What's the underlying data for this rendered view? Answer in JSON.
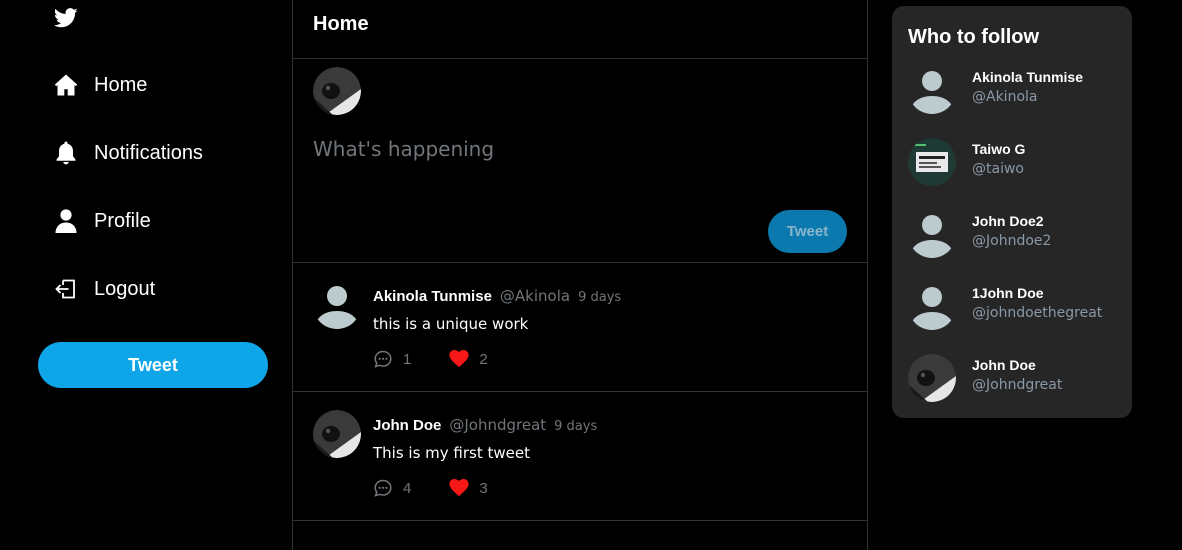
{
  "sidebar": {
    "logo_icon": "twitter-bird-icon",
    "items": [
      {
        "label": "Home",
        "icon": "home-icon"
      },
      {
        "label": "Notifications",
        "icon": "bell-icon"
      },
      {
        "label": "Profile",
        "icon": "user-icon"
      },
      {
        "label": "Logout",
        "icon": "logout-icon"
      }
    ],
    "tweet_button_label": "Tweet"
  },
  "main": {
    "title": "Home",
    "composer": {
      "placeholder": "What's happening",
      "button_label": "Tweet"
    },
    "tweets": [
      {
        "name": "Akinola Tunmise",
        "handle": "@Akinola",
        "time": "9 days",
        "text": "this is a unique work",
        "avatar": "default-avatar",
        "comments": "1",
        "likes": "2"
      },
      {
        "name": "John Doe",
        "handle": "@Johndgreat",
        "time": "9 days",
        "text": "This is my first tweet",
        "avatar": "photo-avatar",
        "comments": "4",
        "likes": "3"
      }
    ]
  },
  "who_to_follow": {
    "title": "Who to follow",
    "users": [
      {
        "name": "Akinola Tunmise",
        "handle": "@Akinola",
        "avatar": "default-avatar"
      },
      {
        "name": "Taiwo G",
        "handle": "@taiwo",
        "avatar": "screenshot-avatar"
      },
      {
        "name": "John Doe2",
        "handle": "@Johndoe2",
        "avatar": "default-avatar"
      },
      {
        "name": "1John Doe",
        "handle": "@johndoethegreat",
        "avatar": "default-avatar"
      },
      {
        "name": "John Doe",
        "handle": "@Johndgreat",
        "avatar": "photo-avatar"
      }
    ]
  },
  "colors": {
    "background": "#000000",
    "accent": "#0ea5e9",
    "compose_button": "#0b79ad",
    "panel": "#262626",
    "like": "#f91818",
    "muted_text": "#71767b"
  }
}
